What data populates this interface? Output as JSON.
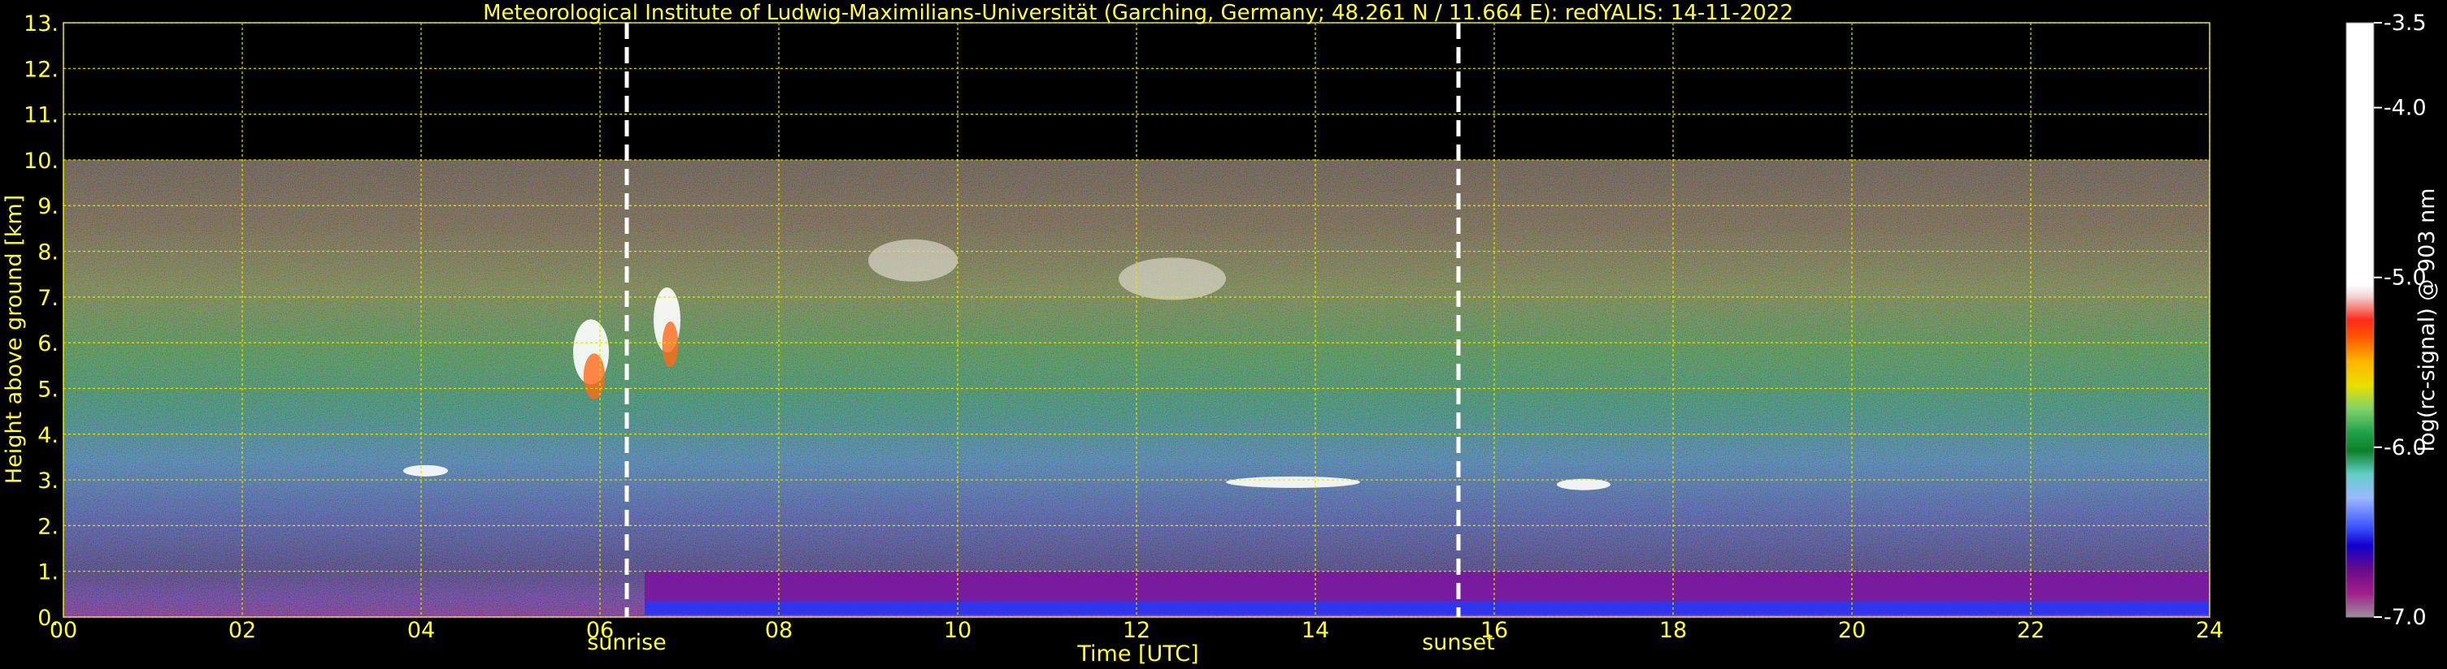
{
  "chart_data": {
    "type": "heatmap",
    "title": "Meteorological Institute of Ludwig-Maximilians-Universität (Garching, Germany; 48.261 N / 11.664 E):    redYALIS: 14-11-2022",
    "xlabel": "Time [UTC]",
    "ylabel": "Height above ground [km]",
    "xlim": [
      0,
      24
    ],
    "ylim": [
      0,
      13
    ],
    "x_ticks": [
      "00",
      "02",
      "04",
      "06",
      "08",
      "10",
      "12",
      "14",
      "16",
      "18",
      "20",
      "22",
      "24"
    ],
    "x_tick_values": [
      0,
      2,
      4,
      6,
      8,
      10,
      12,
      14,
      16,
      18,
      20,
      22,
      24
    ],
    "y_ticks": [
      "0.",
      "1.",
      "2.",
      "3.",
      "4.",
      "5.",
      "6.",
      "7.",
      "8.",
      "9.",
      "10.",
      "11.",
      "12.",
      "13."
    ],
    "y_tick_values": [
      0,
      1,
      2,
      3,
      4,
      5,
      6,
      7,
      8,
      9,
      10,
      11,
      12,
      13
    ],
    "grid": true,
    "data_ceiling_km": 10,
    "events": [
      {
        "label": "sunrise",
        "time": 6.3
      },
      {
        "label": "sunset",
        "time": 15.6
      }
    ],
    "colorbar": {
      "label": "log(rc-signal) @ 903 nm",
      "range": [
        -7.0,
        -3.5
      ],
      "ticks": [
        "-3.5",
        "-4.0",
        "-5.0",
        "-6.0",
        "-7.0"
      ],
      "tick_values": [
        -3.5,
        -4.0,
        -5.0,
        -6.0,
        -7.0
      ]
    },
    "features": [
      {
        "name": "cloud-layer-a",
        "time_start": 3.8,
        "time_end": 4.3,
        "height_km": 3.2
      },
      {
        "name": "cloud-layer-b",
        "time_start": 13.0,
        "time_end": 14.5,
        "height_km": 2.95
      },
      {
        "name": "cloud-layer-c",
        "time_start": 16.7,
        "time_end": 17.3,
        "height_km": 2.9
      },
      {
        "name": "fallstreak-a",
        "time_start": 5.7,
        "time_end": 6.1,
        "height_km": 5.8
      },
      {
        "name": "fallstreak-b",
        "time_start": 6.6,
        "time_end": 6.9,
        "height_km": 6.5
      },
      {
        "name": "ice-cloud-a",
        "time_start": 9.0,
        "time_end": 10.0,
        "height_km": 7.8
      },
      {
        "name": "ice-cloud-b",
        "time_start": 11.8,
        "time_end": 13.0,
        "height_km": 7.4
      },
      {
        "name": "boundary-layer",
        "time_start": 6.5,
        "time_end": 24.0,
        "height_km": 0.4
      }
    ]
  }
}
